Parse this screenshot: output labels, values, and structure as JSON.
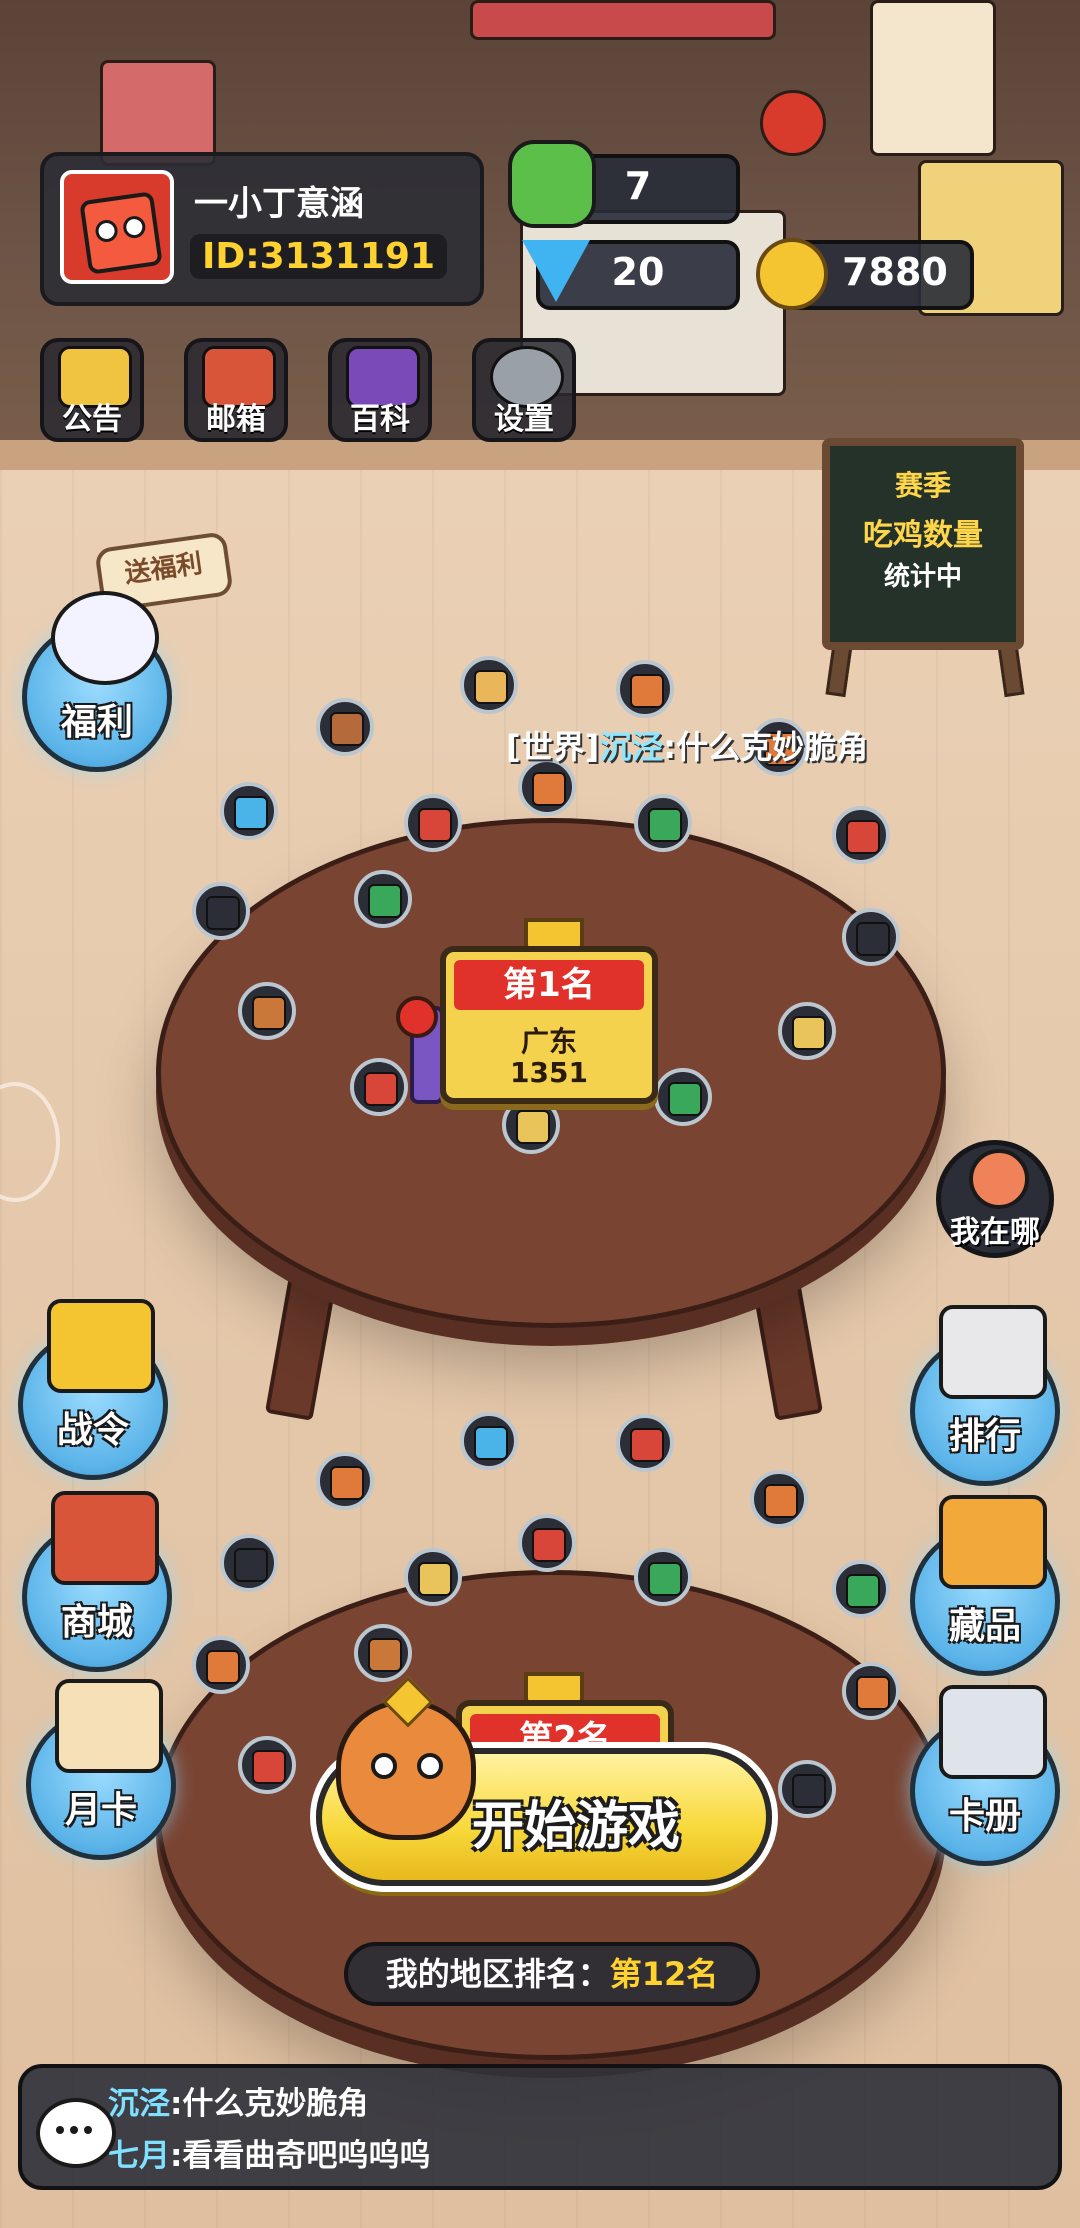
{
  "profile": {
    "username": "一小丁意涵",
    "user_id": "ID:3131191"
  },
  "currency": {
    "tickets": "7",
    "diamonds": "20",
    "coins": "7880"
  },
  "top_menu": {
    "notice": "公告",
    "mail": "邮箱",
    "wiki": "百科",
    "settings": "设置"
  },
  "chalkboard": {
    "line1": "赛季",
    "line2": "吃鸡数量",
    "line3": "统计中"
  },
  "left_menu": {
    "welfare_tag": "送福利",
    "welfare": "福利",
    "battle_pass": "战令",
    "shop": "商城",
    "monthly_card": "月卡"
  },
  "right_menu": {
    "where_am_i": "我在哪",
    "ranking": "排行",
    "collection": "藏品",
    "card_album": "卡册"
  },
  "world_chat": {
    "tag": "[世界]",
    "name": "沉泾",
    "message": ":什么克妙脆角"
  },
  "table1": {
    "rank": "第1名",
    "region": "广东",
    "score": "1351"
  },
  "table2": {
    "rank": "第2名"
  },
  "start_button": "开始游戏",
  "region_rank": {
    "label": "我的地区排名：",
    "value": "第12名"
  },
  "chat_bar": {
    "lines": [
      {
        "name": "沉泾",
        "text": ":什么克妙脆角"
      },
      {
        "name": "七月",
        "text": ":看看曲奇吧呜呜呜"
      }
    ]
  },
  "colors": {
    "accent_yellow": "#ffd230",
    "rank_red": "#e0322a",
    "chat_name": "#7fe0ff",
    "side_button_blue": "#5ab3e8"
  }
}
